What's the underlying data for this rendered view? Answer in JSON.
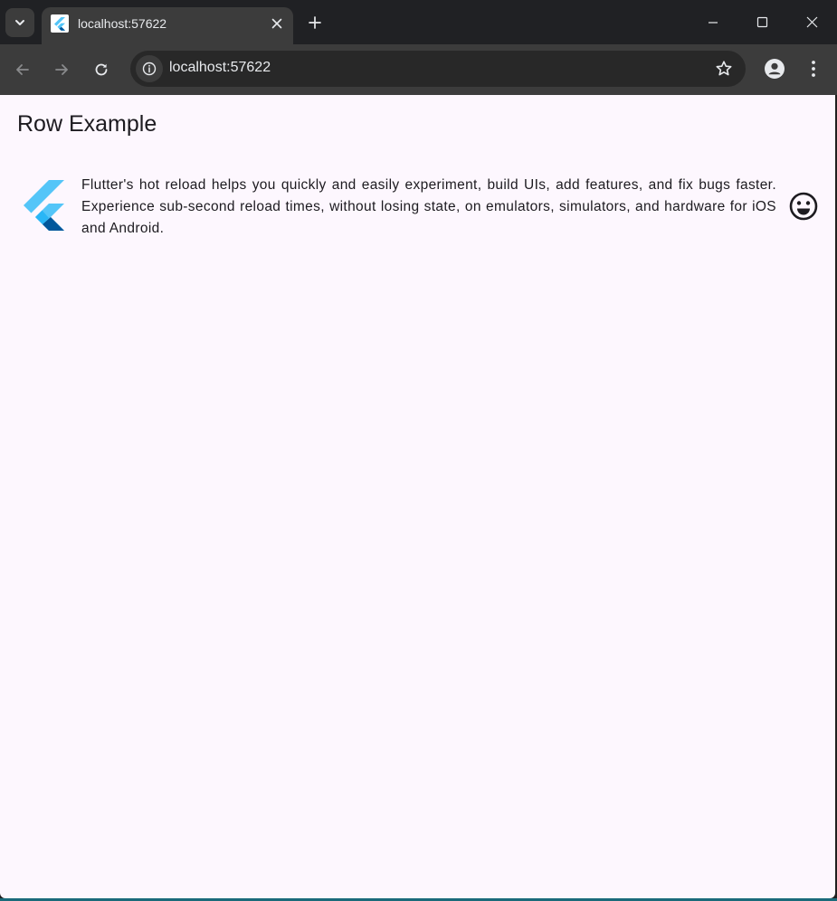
{
  "browser": {
    "tab": {
      "title": "localhost:57622"
    },
    "address_bar": {
      "url": "localhost:57622"
    }
  },
  "icons": {
    "tab_search": "chevron-down-icon",
    "favicon": "flutter-icon",
    "tab_close": "close-icon",
    "new_tab": "plus-icon",
    "minimize": "minimize-icon",
    "maximize": "maximize-icon",
    "close_window": "close-icon",
    "back": "arrow-left-icon",
    "forward": "arrow-right-icon",
    "reload": "reload-icon",
    "site_info": "info-icon",
    "bookmark": "star-icon",
    "profile": "person-icon",
    "menu": "more-vert-icon",
    "row_leading": "flutter-logo",
    "row_trailing": "sentiment-very-satisfied-icon"
  },
  "page": {
    "title": "Row Example",
    "row_text": "Flutter's hot reload helps you quickly and easily experiment, build UIs, add features, and fix bugs faster. Experience sub-second reload times, without losing state, on emulators, simulators, and hardware for iOS and Android."
  },
  "colors": {
    "page_background": "#fdf7fe",
    "browser_frame": "#202124",
    "toolbar": "#3c3c3c",
    "flutter_light": "#54c5f8",
    "flutter_dark": "#01579b",
    "text": "#1d1b20"
  }
}
